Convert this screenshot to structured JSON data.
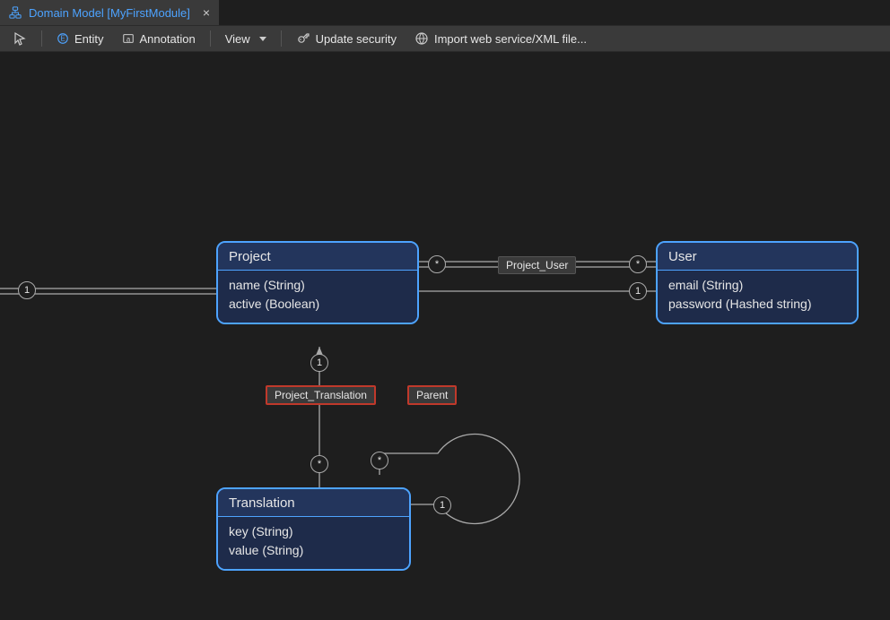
{
  "tab": {
    "title": "Domain Model [MyFirstModule]"
  },
  "toolbar": {
    "entity_label": "Entity",
    "annotation_label": "Annotation",
    "view_label": "View",
    "update_security_label": "Update security",
    "import_label": "Import web service/XML file..."
  },
  "entities": {
    "project": {
      "name": "Project",
      "attrs": [
        "name (String)",
        "active (Boolean)"
      ]
    },
    "user": {
      "name": "User",
      "attrs": [
        "email (String)",
        "password (Hashed string)"
      ]
    },
    "translation": {
      "name": "Translation",
      "attrs": [
        "key (String)",
        "value (String)"
      ]
    }
  },
  "associations": {
    "project_user": {
      "label": "Project_User",
      "left_mult": "*",
      "right_mult": "*"
    },
    "project_translation": {
      "label": "Project_Translation",
      "top_mult": "1",
      "bottom_mult": "*"
    },
    "parent": {
      "label": "Parent",
      "self_mult_top": "*",
      "self_mult_bottom": "1"
    }
  },
  "offscreen": {
    "left_line_mult": "1",
    "left_line_mult2": "1"
  }
}
